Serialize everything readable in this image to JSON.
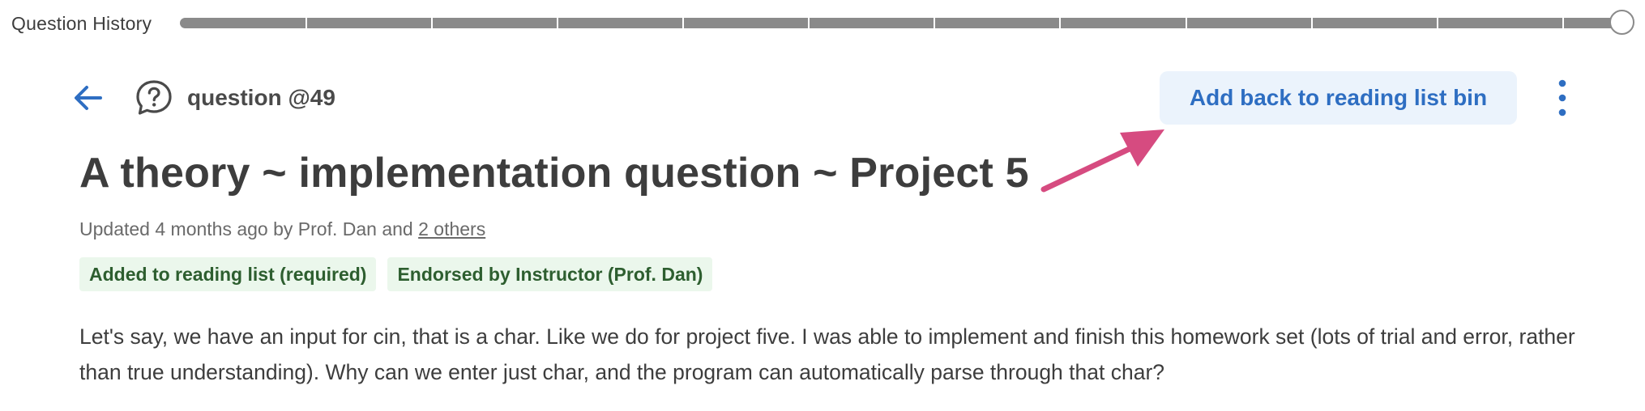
{
  "history": {
    "label": "Question History",
    "segments": 11
  },
  "header": {
    "back_icon": "arrow-left-icon",
    "type_icon": "question-bubble-icon",
    "post_label": "question @49",
    "action_label": "Add back to reading list bin",
    "more_icon": "kebab-menu-icon"
  },
  "post": {
    "title": "A theory ~ implementation question ~ Project 5",
    "meta_prefix": "Updated 4 months ago by Prof. Dan and ",
    "meta_link": "2 others",
    "badges": [
      "Added to reading list (required)",
      "Endorsed by Instructor (Prof. Dan)"
    ],
    "body": "Let's say, we have an input for cin, that is a char. Like we do for project five. I was able to implement and finish this homework set (lots of trial and error, rather than true understanding). Why can we enter just char, and the program can automatically parse through that char?"
  },
  "colors": {
    "accent": "#2e6ec2",
    "annotation_arrow": "#d64b80",
    "badge_bg": "#ebf7ec",
    "badge_text": "#2d5e2f"
  }
}
